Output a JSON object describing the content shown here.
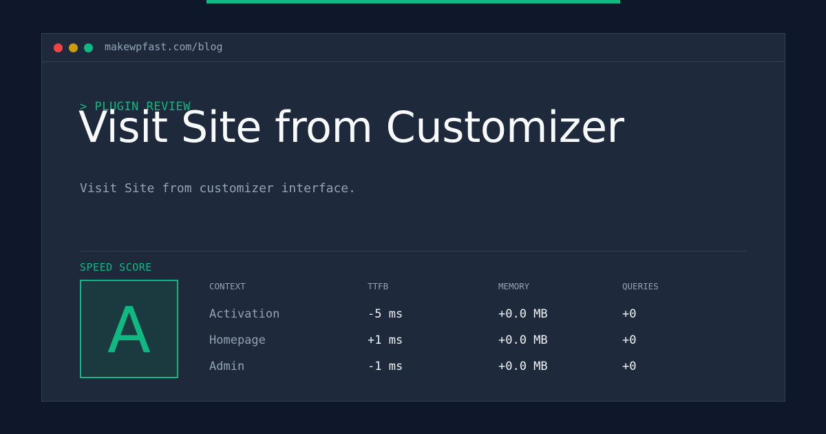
{
  "browser": {
    "url": "makewpfast.com/blog"
  },
  "hero": {
    "kicker": "> PLUGIN REVIEW",
    "title": "Visit Site from Customizer",
    "subtitle": "Visit Site from customizer interface."
  },
  "score": {
    "label": "SPEED SCORE",
    "grade": "A"
  },
  "metrics": {
    "headers": [
      "CONTEXT",
      "TTFB",
      "MEMORY",
      "QUERIES"
    ],
    "rows": [
      {
        "context": "Activation",
        "ttfb": "-5 ms",
        "memory": "+0.0 MB",
        "queries": "+0"
      },
      {
        "context": "Homepage",
        "ttfb": "+1 ms",
        "memory": "+0.0 MB",
        "queries": "+0"
      },
      {
        "context": "Admin",
        "ttfb": "-1 ms",
        "memory": "+0.0 MB",
        "queries": "+0"
      }
    ]
  },
  "colors": {
    "background": "#0f172a",
    "panel": "#1e293b",
    "accent": "#10b981",
    "text": "#f8fafc",
    "muted": "#94a3b8",
    "dot_red": "#ef4444",
    "dot_yellow": "#eab308",
    "dot_green": "#10b981"
  }
}
